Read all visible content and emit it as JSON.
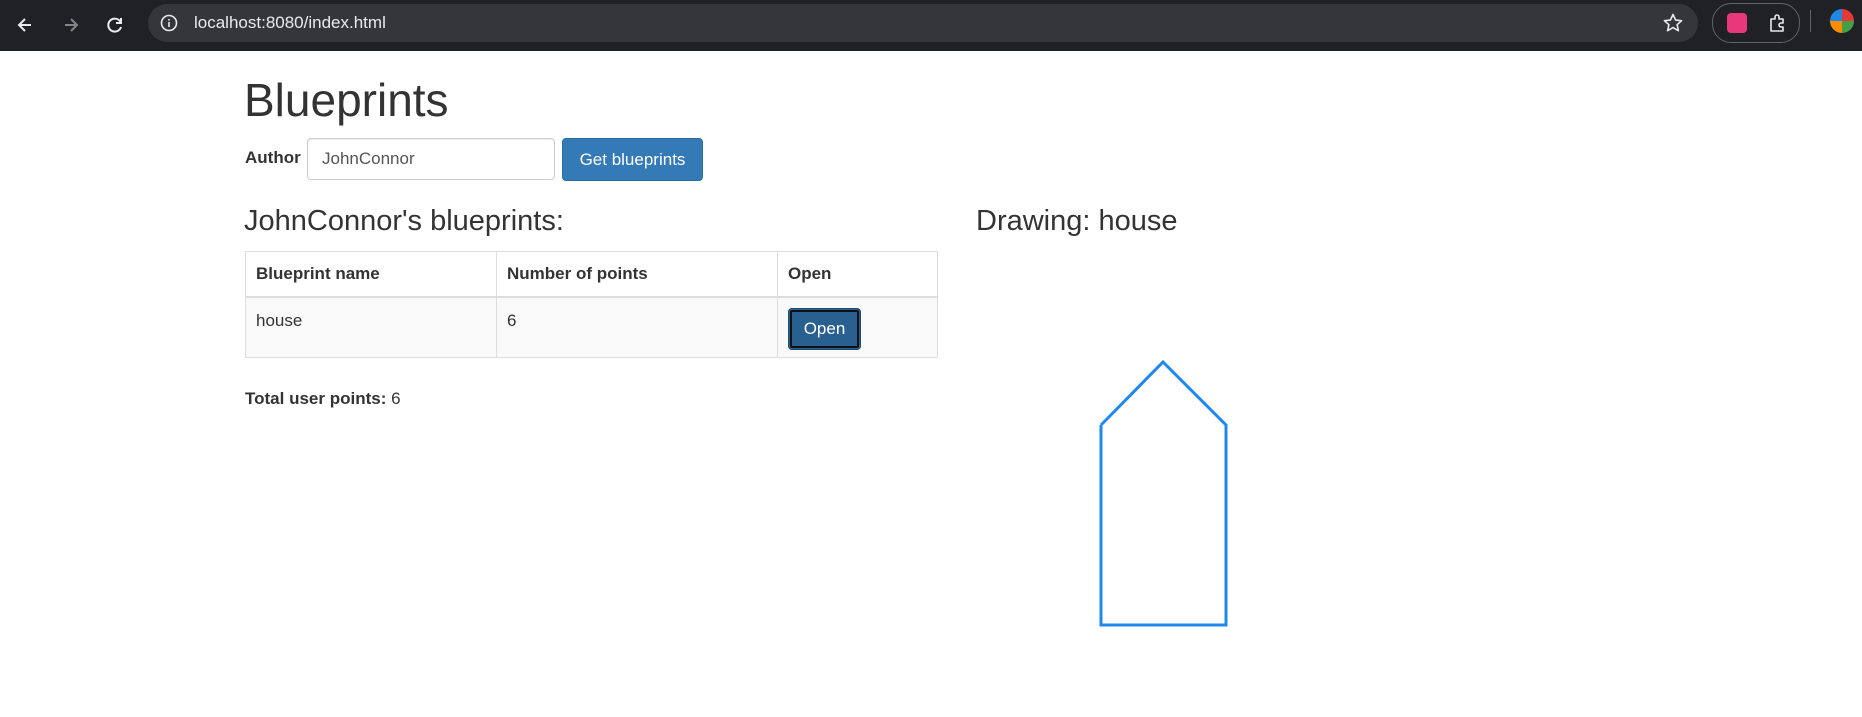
{
  "browser": {
    "url": "localhost:8080/index.html"
  },
  "page": {
    "title": "Blueprints",
    "author_label": "Author",
    "author_value": "JohnConnor",
    "get_button": "Get blueprints",
    "list_title": "JohnConnor's blueprints:",
    "table": {
      "headers": [
        "Blueprint name",
        "Number of points",
        "Open"
      ],
      "rows": [
        {
          "name": "house",
          "points": "6",
          "action": "Open"
        }
      ]
    },
    "total_label": "Total user points:",
    "total_value": "6",
    "drawing_title": "Drawing: house"
  },
  "colors": {
    "accent": "#337ab7",
    "drawing_stroke": "#1e88f0"
  },
  "icons": [
    "back-arrow-icon",
    "forward-arrow-icon",
    "reload-icon",
    "site-info-icon",
    "bookmark-star-icon",
    "translate-extension-icon",
    "extensions-puzzle-icon",
    "profile-avatar-icon"
  ]
}
